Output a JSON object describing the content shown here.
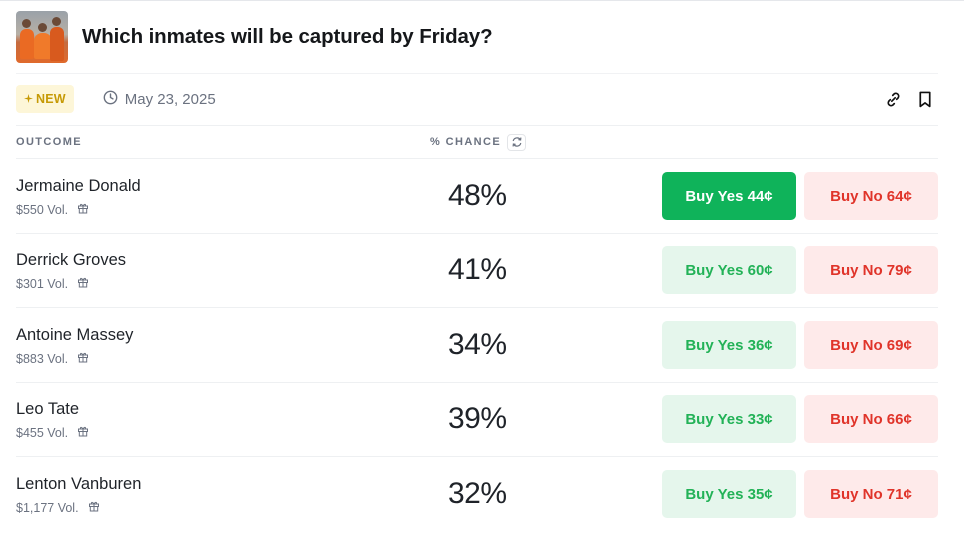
{
  "market": {
    "title": "Which inmates will be captured by Friday?",
    "badge": "NEW",
    "date": "May 23, 2025"
  },
  "table": {
    "outcome_header": "OUTCOME",
    "chance_header": "% CHANCE",
    "rows": [
      {
        "name": "Jermaine Donald",
        "volume": "$550 Vol.",
        "chance": "48%",
        "yes": "Buy Yes 44¢",
        "no": "Buy No 64¢"
      },
      {
        "name": "Derrick Groves",
        "volume": "$301 Vol.",
        "chance": "41%",
        "yes": "Buy Yes 60¢",
        "no": "Buy No 79¢"
      },
      {
        "name": "Antoine Massey",
        "volume": "$883 Vol.",
        "chance": "34%",
        "yes": "Buy Yes 36¢",
        "no": "Buy No 69¢"
      },
      {
        "name": "Leo Tate",
        "volume": "$455 Vol.",
        "chance": "39%",
        "yes": "Buy Yes 33¢",
        "no": "Buy No 66¢"
      },
      {
        "name": "Lenton Vanburen",
        "volume": "$1,177 Vol.",
        "chance": "32%",
        "yes": "Buy Yes 35¢",
        "no": "Buy No 71¢"
      }
    ]
  },
  "colors": {
    "yes_active": "#0fb35a",
    "yes_bg": "#e5f6ec",
    "no_bg": "#feeaea",
    "no_text": "#e0342a",
    "badge_bg": "#fdf6d8",
    "badge_text": "#c69a06"
  },
  "icons": {
    "date": "clock-icon",
    "share": "link-icon",
    "save": "bookmark-icon",
    "refresh": "refresh-icon",
    "volume": "gift-icon",
    "badge": "sparkle-icon"
  }
}
